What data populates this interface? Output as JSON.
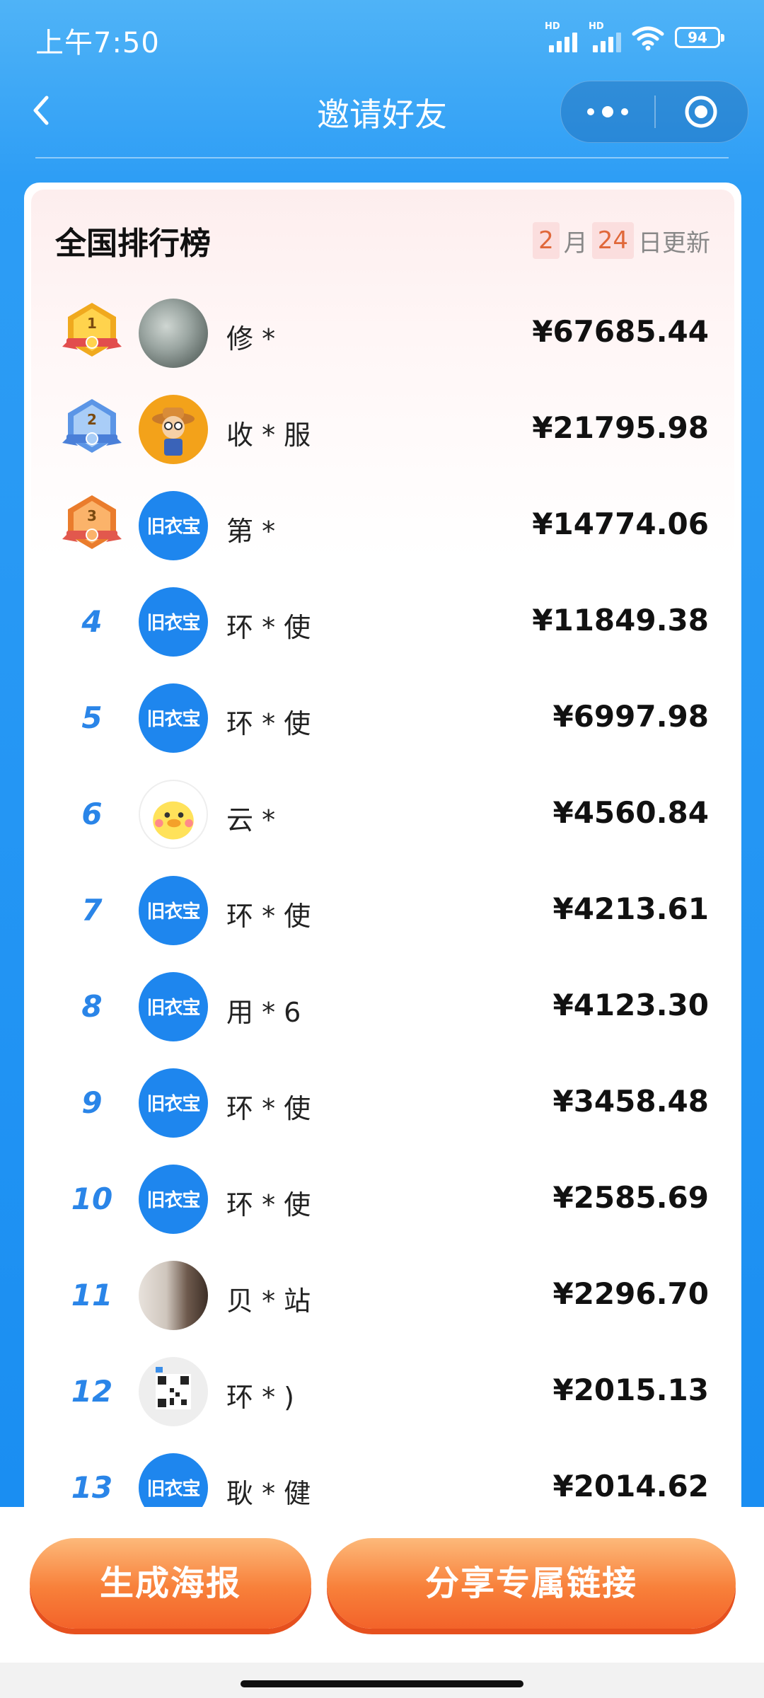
{
  "status_bar": {
    "time": "上午7:50",
    "signal_label": "HD",
    "battery": "94"
  },
  "nav": {
    "title": "邀请好友",
    "back_icon": "chevron-left-icon",
    "more_icon": "more-dots-icon",
    "close_icon": "target-close-icon"
  },
  "leaderboard": {
    "title": "全国排行榜",
    "update": {
      "month": "2",
      "month_unit": "月",
      "day": "24",
      "day_unit": "日更新"
    },
    "rows": [
      {
        "rank": "1",
        "name": "修 *",
        "amount": "¥67685.44",
        "avatar": "photo-bags"
      },
      {
        "rank": "2",
        "name": "收 * 服",
        "amount": "¥21795.98",
        "avatar": "cartoon-farmer"
      },
      {
        "rank": "3",
        "name": "第 *",
        "amount": "¥14774.06",
        "avatar": "brand"
      },
      {
        "rank": "4",
        "name": "环 * 使",
        "amount": "¥11849.38",
        "avatar": "brand"
      },
      {
        "rank": "5",
        "name": "环 * 使",
        "amount": "¥6997.98",
        "avatar": "brand"
      },
      {
        "rank": "6",
        "name": "云 *",
        "amount": "¥4560.84",
        "avatar": "duck"
      },
      {
        "rank": "7",
        "name": "环 * 使",
        "amount": "¥4213.61",
        "avatar": "brand"
      },
      {
        "rank": "8",
        "name": "用 * 6",
        "amount": "¥4123.30",
        "avatar": "brand"
      },
      {
        "rank": "9",
        "name": "环 * 使",
        "amount": "¥3458.48",
        "avatar": "brand"
      },
      {
        "rank": "10",
        "name": "环 * 使",
        "amount": "¥2585.69",
        "avatar": "brand"
      },
      {
        "rank": "11",
        "name": "贝 * 站",
        "amount": "¥2296.70",
        "avatar": "photo-hair"
      },
      {
        "rank": "12",
        "name": "环 * )",
        "amount": "¥2015.13",
        "avatar": "qr-code"
      },
      {
        "rank": "13",
        "name": "耿 * 健",
        "amount": "¥2014.62",
        "avatar": "brand"
      }
    ],
    "brand_avatar_text": "旧衣宝"
  },
  "actions": {
    "poster_label": "生成海报",
    "share_label": "分享专属链接"
  },
  "colors": {
    "header_blue": "#2d9df5",
    "rank_blue": "#2a85e8",
    "button_orange": "#f8803a",
    "date_highlight": "#fbdede"
  }
}
